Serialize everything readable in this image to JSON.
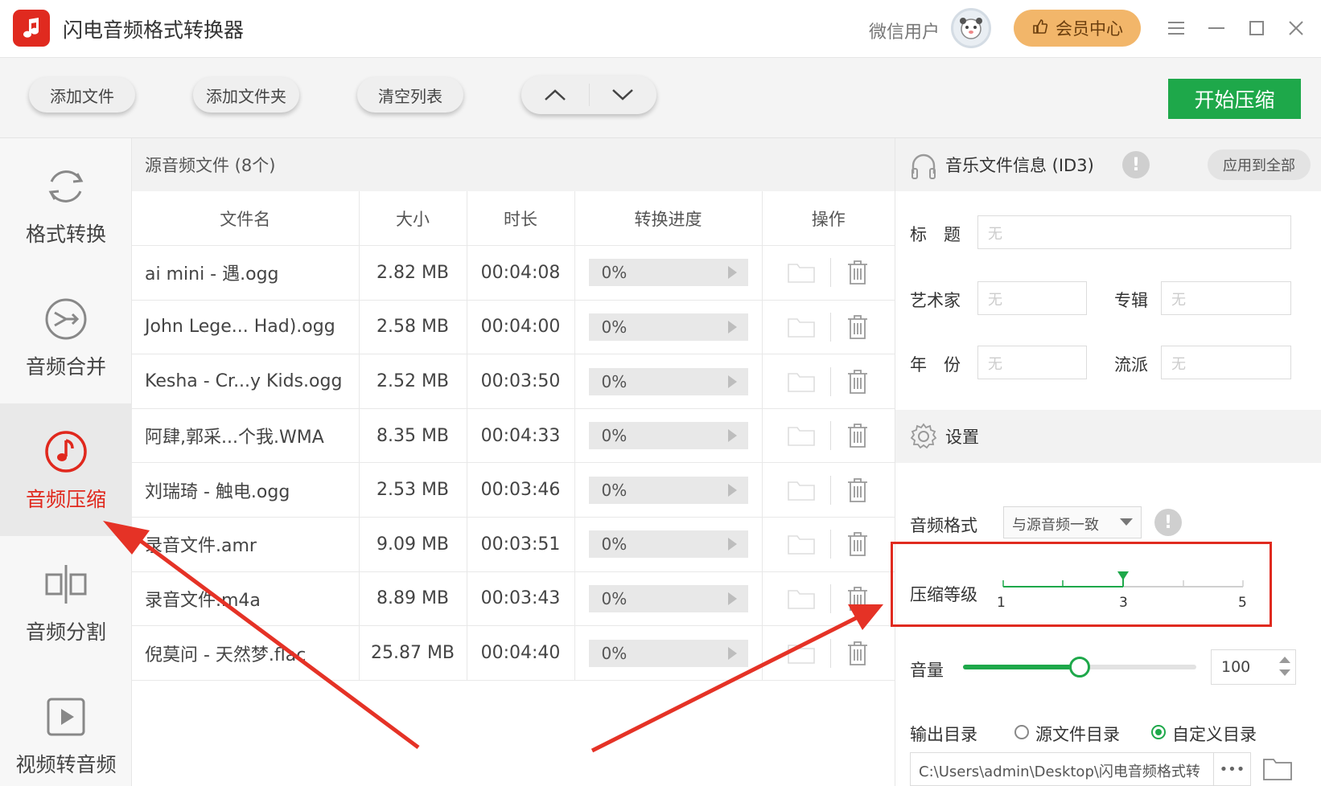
{
  "app": {
    "title": "闪电音频格式转换器"
  },
  "titlebar": {
    "user_name": "微信用户",
    "vip_label": "会员中心"
  },
  "toolbar": {
    "add_file": "添加文件",
    "add_folder": "添加文件夹",
    "clear_list": "清空列表",
    "start": "开始压缩"
  },
  "nav": {
    "items": [
      {
        "label": "格式转换",
        "icon": "refresh-icon"
      },
      {
        "label": "音频合并",
        "icon": "merge-icon"
      },
      {
        "label": "音频压缩",
        "icon": "music-note-icon",
        "active": true
      },
      {
        "label": "音频分割",
        "icon": "split-icon"
      },
      {
        "label": "视频转音频",
        "icon": "play-icon"
      }
    ]
  },
  "files": {
    "header": "源音频文件 (8个)",
    "columns": [
      "文件名",
      "大小",
      "时长",
      "转换进度",
      "操作"
    ],
    "rows": [
      {
        "name": "ai mini - 遇.ogg",
        "size": "2.82 MB",
        "duration": "00:04:08",
        "progress": "0%"
      },
      {
        "name": "John Lege... Had).ogg",
        "size": "2.58 MB",
        "duration": "00:04:00",
        "progress": "0%"
      },
      {
        "name": "Kesha - Cr...y Kids.ogg",
        "size": "2.52 MB",
        "duration": "00:03:50",
        "progress": "0%"
      },
      {
        "name": "阿肆,郭采...个我.WMA",
        "size": "8.35 MB",
        "duration": "00:04:33",
        "progress": "0%"
      },
      {
        "name": "刘瑞琦 - 触电.ogg",
        "size": "2.53 MB",
        "duration": "00:03:46",
        "progress": "0%"
      },
      {
        "name": "录音文件.amr",
        "size": "9.09 MB",
        "duration": "00:03:51",
        "progress": "0%"
      },
      {
        "name": "录音文件.m4a",
        "size": "8.89 MB",
        "duration": "00:03:43",
        "progress": "0%"
      },
      {
        "name": "倪莫问 - 天然梦.flac",
        "size": "25.87 MB",
        "duration": "00:04:40",
        "progress": "0%"
      }
    ]
  },
  "id3": {
    "title": "音乐文件信息 (ID3)",
    "apply_all": "应用到全部",
    "title_label": "标　题",
    "artist_label": "艺术家",
    "album_label": "专辑",
    "year_label": "年　份",
    "genre_label": "流派",
    "empty_placeholder": "无"
  },
  "settings": {
    "title": "设置",
    "format_label": "音频格式",
    "format_value": "与源音频一致",
    "compress_label": "压缩等级",
    "compress_min": "1",
    "compress_mid": "3",
    "compress_max": "5",
    "compress_level": 3,
    "volume_label": "音量",
    "volume_value": "100",
    "volume_fraction": 0.5,
    "output_label": "输出目录",
    "output_source": "源文件目录",
    "output_custom": "自定义目录",
    "output_path": "C:\\Users\\admin\\Desktop\\闪电音频格式转",
    "more": "•••"
  },
  "colors": {
    "accent_red": "#e02a1f",
    "accent_green": "#1ea84a",
    "vip_orange": "#f2b66a"
  }
}
